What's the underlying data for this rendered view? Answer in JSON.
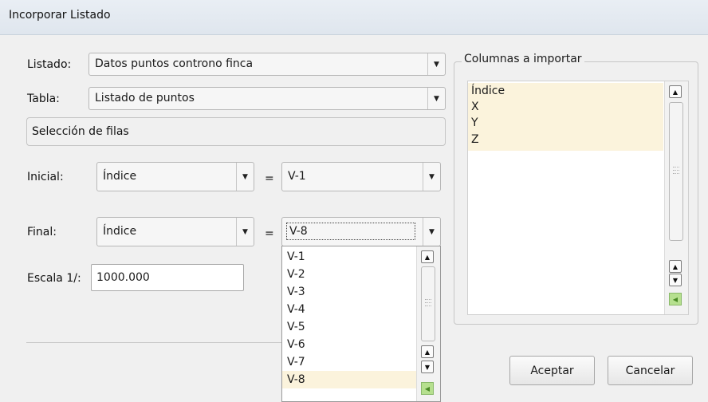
{
  "window": {
    "title": "Incorporar Listado"
  },
  "form": {
    "listado_label": "Listado:",
    "listado_value": "Datos puntos controno finca",
    "tabla_label": "Tabla:",
    "tabla_value": "Listado de puntos",
    "seleccion_label": "Selección de filas",
    "inicial_label": "Inicial:",
    "inicial_field": "Índice",
    "inicial_value": "V-1",
    "final_label": "Final:",
    "final_field": "Índice",
    "final_value": "V-8",
    "equals": "=",
    "escala_label": "Escala 1/:",
    "escala_value": "1000.000"
  },
  "columns": {
    "title": "Columnas a importar",
    "items": [
      "Índice",
      "X",
      "Y",
      "Z"
    ]
  },
  "dropdown": {
    "options": [
      "V-1",
      "V-2",
      "V-3",
      "V-4",
      "V-5",
      "V-6",
      "V-7",
      "V-8"
    ],
    "selected": "V-8"
  },
  "buttons": {
    "accept": "Aceptar",
    "cancel": "Cancelar"
  },
  "colors": {
    "selection_bg": "#fbf3dc",
    "scroll_green": "#b6e08f"
  }
}
